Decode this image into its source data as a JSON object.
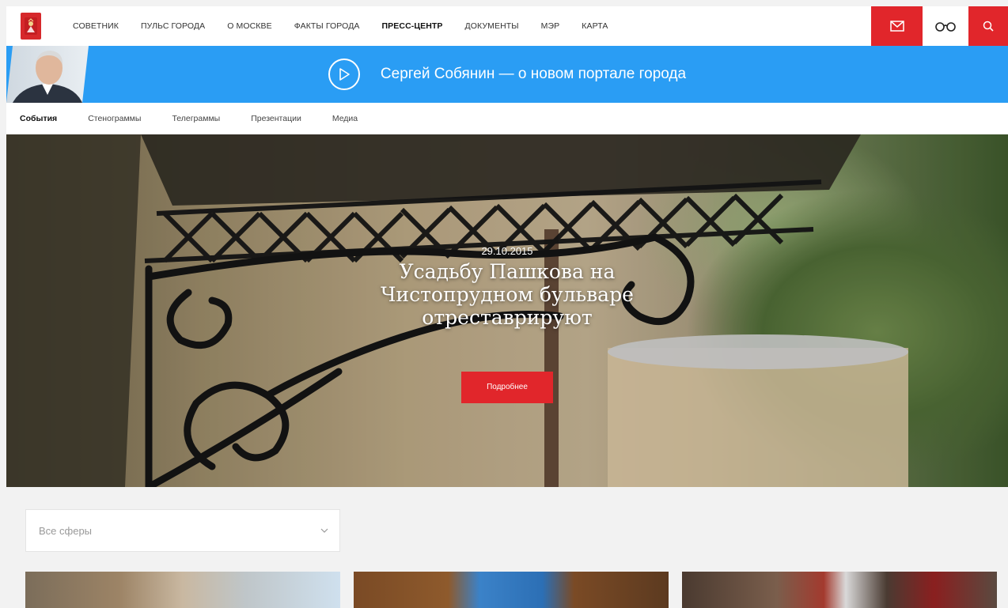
{
  "nav": {
    "items": [
      {
        "label": "СОВЕТНИК",
        "active": false
      },
      {
        "label": "ПУЛЬС ГОРОДА",
        "active": false
      },
      {
        "label": "О МОСКВЕ",
        "active": false
      },
      {
        "label": "ФАКТЫ ГОРОДА",
        "active": false
      },
      {
        "label": "ПРЕСС-ЦЕНТР",
        "active": true
      },
      {
        "label": "ДОКУМЕНТЫ",
        "active": false
      },
      {
        "label": "МЭР",
        "active": false
      },
      {
        "label": "КАРТА",
        "active": false
      }
    ],
    "icons": {
      "logo": "moscow-coat-of-arms-icon",
      "mail": "mail-icon",
      "glasses": "glasses-icon",
      "search": "search-icon"
    }
  },
  "banner": {
    "text": "Сергей Собянин — о новом портале города",
    "icon": "play-icon"
  },
  "subnav": {
    "items": [
      {
        "label": "События",
        "active": true
      },
      {
        "label": "Стенограммы",
        "active": false
      },
      {
        "label": "Телеграммы",
        "active": false
      },
      {
        "label": "Презентации",
        "active": false
      },
      {
        "label": "Медиа",
        "active": false
      }
    ]
  },
  "hero": {
    "date": "29.10.2015",
    "title": "Усадьбу Пашкова на Чистопрудном бульваре отреставрируют",
    "button": "Подробнее"
  },
  "filter": {
    "value": "Все сферы",
    "icon": "chevron-down-icon"
  },
  "colors": {
    "accent_red": "#e1262b",
    "banner_blue": "#2a9df4",
    "page_bg": "#f2f2f2"
  }
}
